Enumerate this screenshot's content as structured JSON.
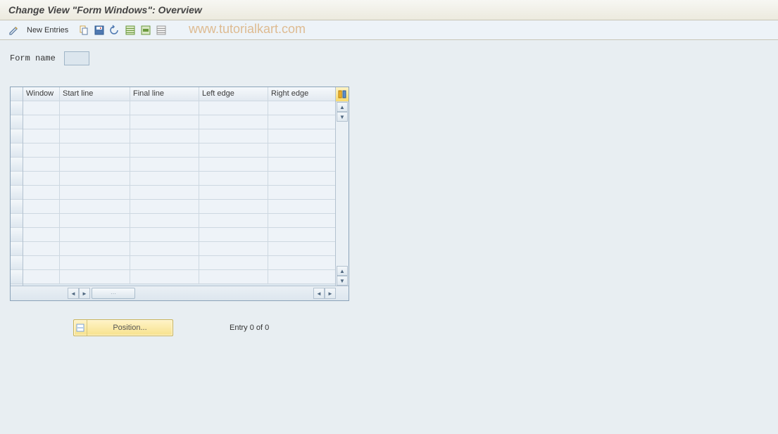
{
  "title": "Change View \"Form Windows\": Overview",
  "toolbar": {
    "new_entries": "New Entries"
  },
  "watermark": "www.tutorialkart.com",
  "form": {
    "name_label": "Form name",
    "name_value": ""
  },
  "table": {
    "columns": {
      "window": "Window",
      "start_line": "Start line",
      "final_line": "Final line",
      "left_edge": "Left edge",
      "right_edge": "Right edge"
    },
    "row_count": 13
  },
  "footer": {
    "position_label": "Position...",
    "entry_text": "Entry 0 of 0"
  },
  "icons": {
    "pencil": "pencil-icon",
    "copy": "copy-icon",
    "save": "save-icon",
    "undo": "undo-icon",
    "select_all": "select-all-icon",
    "select_block": "select-block-icon",
    "deselect": "deselect-icon",
    "settings": "settings-icon"
  }
}
